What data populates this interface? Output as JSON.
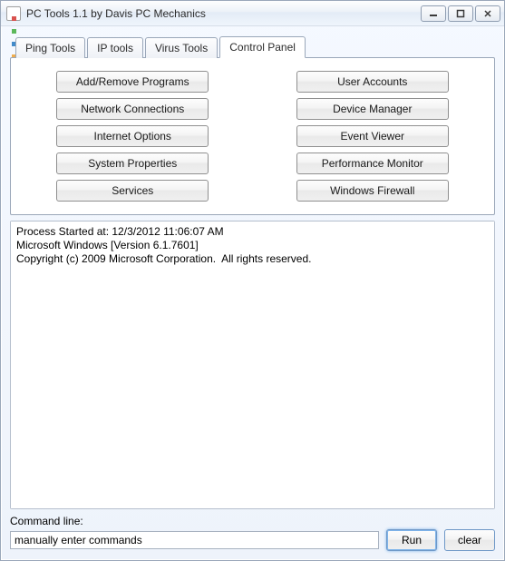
{
  "window": {
    "title": "PC Tools 1.1 by Davis PC Mechanics"
  },
  "tabs": [
    {
      "label": "Ping Tools",
      "active": false
    },
    {
      "label": "IP tools",
      "active": false
    },
    {
      "label": "Virus Tools",
      "active": false
    },
    {
      "label": "Control Panel",
      "active": true
    }
  ],
  "control_panel": {
    "left": [
      "Add/Remove Programs",
      "Network Connections",
      "Internet Options",
      "System Properties",
      "Services"
    ],
    "right": [
      "User Accounts",
      "Device Manager",
      "Event Viewer",
      "Performance Monitor",
      "Windows Firewall"
    ]
  },
  "output_text": "Process Started at: 12/3/2012 11:06:07 AM\nMicrosoft Windows [Version 6.1.7601]\nCopyright (c) 2009 Microsoft Corporation.  All rights reserved.\n",
  "command": {
    "label": "Command line:",
    "value": "manually enter commands",
    "run_label": "Run",
    "clear_label": "clear"
  }
}
